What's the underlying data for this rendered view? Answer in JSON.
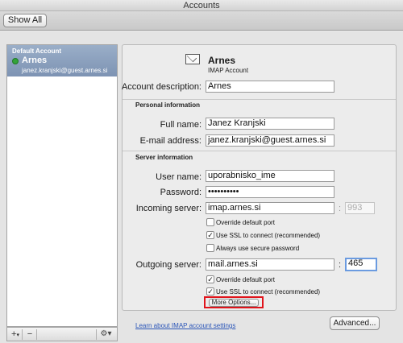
{
  "window": {
    "title": "Accounts"
  },
  "toolbar": {
    "show_all": "Show All"
  },
  "sidebar": {
    "header": "Default Account",
    "account_name": "Arnes",
    "account_email": "janez.kranjski@guest.arnes.si",
    "add": "+",
    "add_menu": "▾",
    "remove": "−",
    "gear": "⚙▾"
  },
  "account": {
    "name": "Arnes",
    "type": "IMAP Account",
    "description_label": "Account description:",
    "description": "Arnes"
  },
  "personal": {
    "heading": "Personal information",
    "full_name_label": "Full name:",
    "full_name": "Janez Kranjski",
    "email_label": "E-mail address:",
    "email": "janez.kranjski@guest.arnes.si"
  },
  "server": {
    "heading": "Server information",
    "user_name_label": "User name:",
    "user_name": "uporabnisko_ime",
    "password_label": "Password:",
    "password": "••••••••••",
    "incoming_label": "Incoming server:",
    "incoming": "imap.arnes.si",
    "incoming_port": "993",
    "incoming_override": {
      "label": "Override default port",
      "checked": false
    },
    "incoming_ssl": {
      "label": "Use SSL to connect (recommended)",
      "checked": true
    },
    "secure_password": {
      "label": "Always use secure password",
      "checked": false
    },
    "outgoing_label": "Outgoing server:",
    "outgoing": "mail.arnes.si",
    "outgoing_port": "465",
    "outgoing_override": {
      "label": "Override default port",
      "checked": true
    },
    "outgoing_ssl": {
      "label": "Use SSL to connect (recommended)",
      "checked": true
    },
    "more_options": "More Options..."
  },
  "footer": {
    "learn_link": "Learn about IMAP account settings",
    "advanced": "Advanced..."
  },
  "colors": {
    "highlight_box": "#e0141b",
    "selected_row": "#8ca1bf",
    "link": "#2a55b8"
  }
}
